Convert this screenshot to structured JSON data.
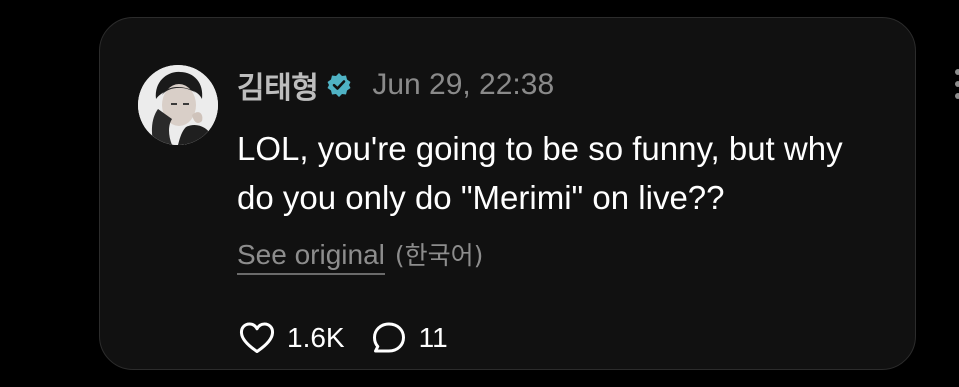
{
  "post": {
    "author": "김태형",
    "verified_icon": "verified-badge-icon",
    "timestamp": "Jun 29, 22:38",
    "text_lines": [
      "LOL, you're going to be so funny, but why",
      "do you only do \"Merimi\" on live??"
    ],
    "see_original_label": "See original",
    "original_language": "(한국어)",
    "likes": "1.6K",
    "replies": "11"
  },
  "colors": {
    "background": "#000000",
    "card": "#111111",
    "badge": "#4fb2c4",
    "muted_text": "#8a8a8a"
  },
  "icons": [
    "avatar",
    "verified-badge-icon",
    "more-options-icon",
    "heart-icon",
    "comment-bubble-icon"
  ]
}
